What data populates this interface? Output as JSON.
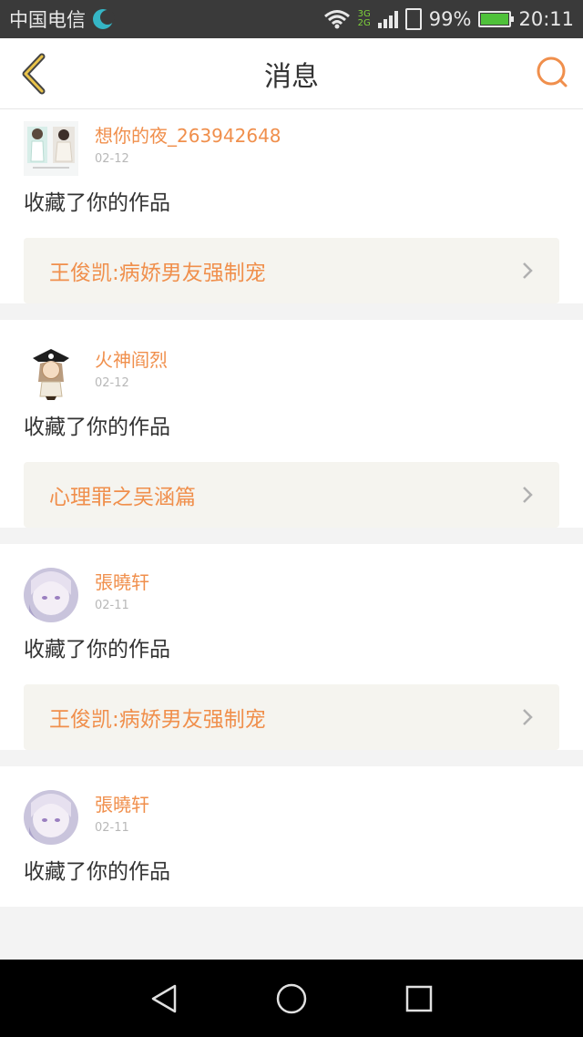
{
  "status_bar": {
    "carrier": "中国电信",
    "net_top": "3G",
    "net_bottom": "2G",
    "battery": "99%",
    "time": "20:11"
  },
  "header": {
    "title": "消息",
    "back_icon": "chevron-left-icon",
    "search_icon": "search-icon"
  },
  "colors": {
    "accent": "#f08f4c",
    "text": "#333333",
    "date": "#b8b8b8",
    "link_bg": "#f5f4ef"
  },
  "messages": [
    {
      "user": "想你的夜_263942648",
      "date": "02-12",
      "action": "收藏了你的作品",
      "work": "王俊凯:病娇男友强制宠"
    },
    {
      "user": "火神阎烈",
      "date": "02-12",
      "action": "收藏了你的作品",
      "work": "心理罪之吴涵篇"
    },
    {
      "user": "張曉轩",
      "date": "02-11",
      "action": "收藏了你的作品",
      "work": "王俊凯:病娇男友强制宠"
    },
    {
      "user": "張曉轩",
      "date": "02-11",
      "action": "收藏了你的作品"
    }
  ],
  "nav": {
    "back_icon": "triangle-back-icon",
    "home_icon": "circle-home-icon",
    "recent_icon": "square-recent-icon"
  }
}
